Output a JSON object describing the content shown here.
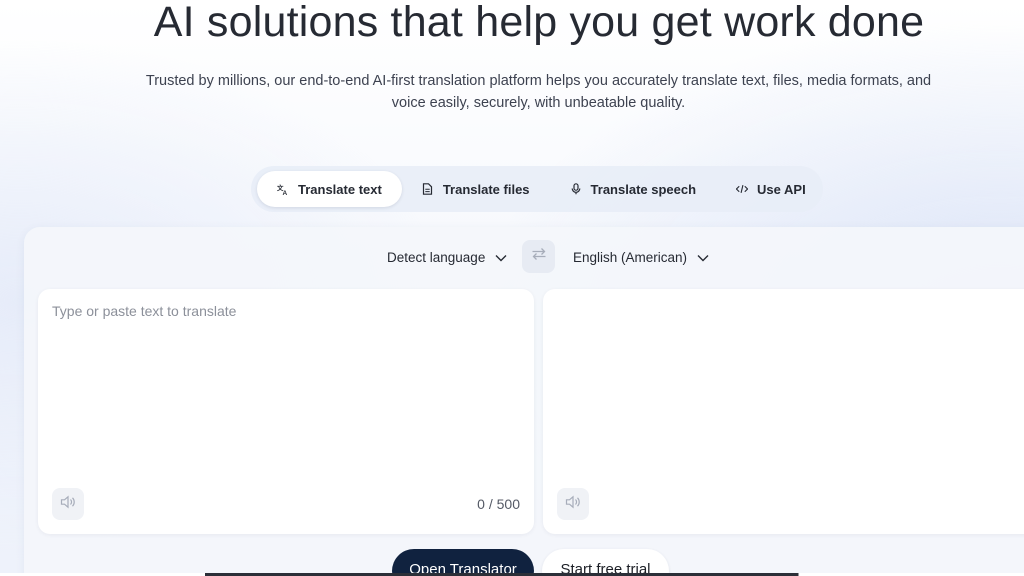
{
  "hero": {
    "title": "AI solutions that help you get work done",
    "subtitle_line1": "Trusted by millions, our end-to-end AI-first translation platform helps you accurately translate text, files, media formats, and",
    "subtitle_line2": "voice easily, securely, with unbeatable quality."
  },
  "tabs": [
    {
      "label": "Translate text",
      "icon": "translate-icon",
      "active": true
    },
    {
      "label": "Translate files",
      "icon": "document-icon",
      "active": false
    },
    {
      "label": "Translate speech",
      "icon": "microphone-icon",
      "active": false
    },
    {
      "label": "Use API",
      "icon": "code-icon",
      "active": false
    }
  ],
  "translator": {
    "source_language": "Detect language",
    "target_language": "English (American)",
    "source_placeholder": "Type or paste text to translate",
    "source_value": "",
    "char_count": "0 / 500",
    "icons": {
      "swap": "swap-arrows-icon",
      "speaker": "speaker-icon",
      "chevron": "chevron-down-icon"
    }
  },
  "cta": {
    "primary_label": "Open Translator",
    "secondary_label": "Start free trial"
  },
  "colors": {
    "primary_button": "#10223f",
    "panel": "#f4f6fb",
    "text": "#262a33"
  }
}
